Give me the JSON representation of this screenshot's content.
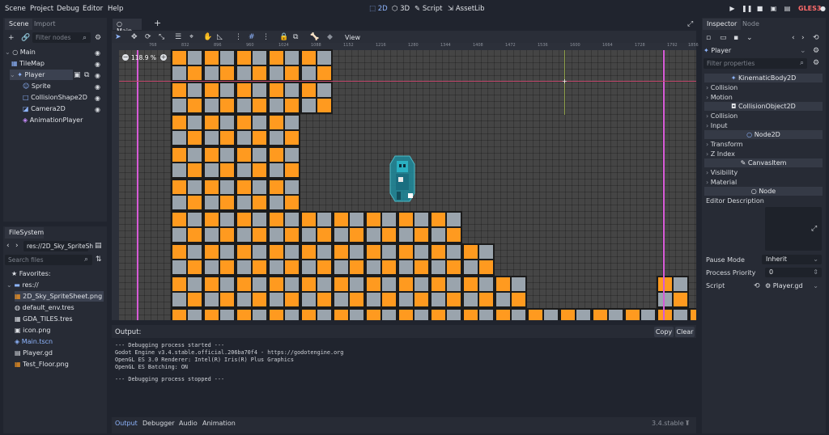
{
  "menu": {
    "items": [
      "Scene",
      "Project",
      "Debug",
      "Editor",
      "Help"
    ]
  },
  "workspaces": {
    "items": [
      "2D",
      "3D",
      "Script",
      "AssetLib"
    ],
    "active": "2D"
  },
  "renderer_label": "GLES3",
  "scene_dock": {
    "tabs": [
      "Scene",
      "Import"
    ],
    "filter_placeholder": "Filter nodes",
    "tree": [
      {
        "label": "Main",
        "icon": "node-circle-icon"
      },
      {
        "label": "TileMap",
        "icon": "tilemap-icon"
      },
      {
        "label": "Player",
        "icon": "kinematic-body-icon"
      },
      {
        "label": "Sprite",
        "icon": "sprite-icon"
      },
      {
        "label": "CollisionShape2D",
        "icon": "collision-shape-icon"
      },
      {
        "label": "Camera2D",
        "icon": "camera-icon"
      },
      {
        "label": "AnimationPlayer",
        "icon": "animation-player-icon"
      }
    ]
  },
  "filesystem": {
    "tab": "FileSystem",
    "path": "res://2D_Sky_SpriteSh",
    "search_placeholder": "Search files",
    "favorites_label": "Favorites:",
    "root_label": "res://",
    "files": [
      "2D_Sky_SpriteSheet.png",
      "default_env.tres",
      "GDA_TILES.tres",
      "icon.png",
      "Main.tscn",
      "Player.gd",
      "Test_Floor.png"
    ]
  },
  "editor_tabs": {
    "main_tab": "Main",
    "add_tab": "+"
  },
  "viewport": {
    "zoom": "118.9 %",
    "view_menu": "View",
    "ruler_marks": [
      "768",
      "832",
      "896",
      "960",
      "1024",
      "1088",
      "1152",
      "1216",
      "1280",
      "1344",
      "1408",
      "1472",
      "1536",
      "1600",
      "1664",
      "1728",
      "1792",
      "1856"
    ]
  },
  "output": {
    "title": "Output:",
    "copy_label": "Copy",
    "clear_label": "Clear",
    "lines": [
      "--- Debugging process started ---",
      "Godot Engine v3.4.stable.official.206ba70f4 - https://godotengine.org",
      "OpenGL ES 3.0 Renderer: Intel(R) Iris(R) Plus Graphics",
      "OpenGL ES Batching: ON",
      "",
      "--- Debugging process stopped ---"
    ]
  },
  "bottom_panel": {
    "tabs": [
      "Output",
      "Debugger",
      "Audio",
      "Animation"
    ],
    "version": "3.4.stable"
  },
  "inspector": {
    "tabs": [
      "Inspector",
      "Node"
    ],
    "object_name": "Player",
    "filter_placeholder": "Filter properties",
    "sections": [
      {
        "header": "KinematicBody2D",
        "rows": [
          "Collision",
          "Motion"
        ]
      },
      {
        "header": "CollisionObject2D",
        "rows": [
          "Collision",
          "Input"
        ]
      },
      {
        "header": "Node2D",
        "rows": [
          "Transform",
          "Z Index"
        ]
      },
      {
        "header": "CanvasItem",
        "rows": [
          "Visibility",
          "Material"
        ]
      },
      {
        "header": "Node",
        "rows": []
      }
    ],
    "editor_description_label": "Editor Description",
    "pause_mode_label": "Pause Mode",
    "pause_mode_value": "Inherit",
    "process_priority_label": "Process Priority",
    "process_priority_value": "0",
    "script_label": "Script",
    "script_value": "Player.gd"
  },
  "colors": {
    "accent": "#8fb6ff",
    "tile_orange": "#ff9a1f",
    "tile_gray": "#9aa4ad",
    "guide_pink": "#d65ad6",
    "gles": "#ff6b6b"
  }
}
